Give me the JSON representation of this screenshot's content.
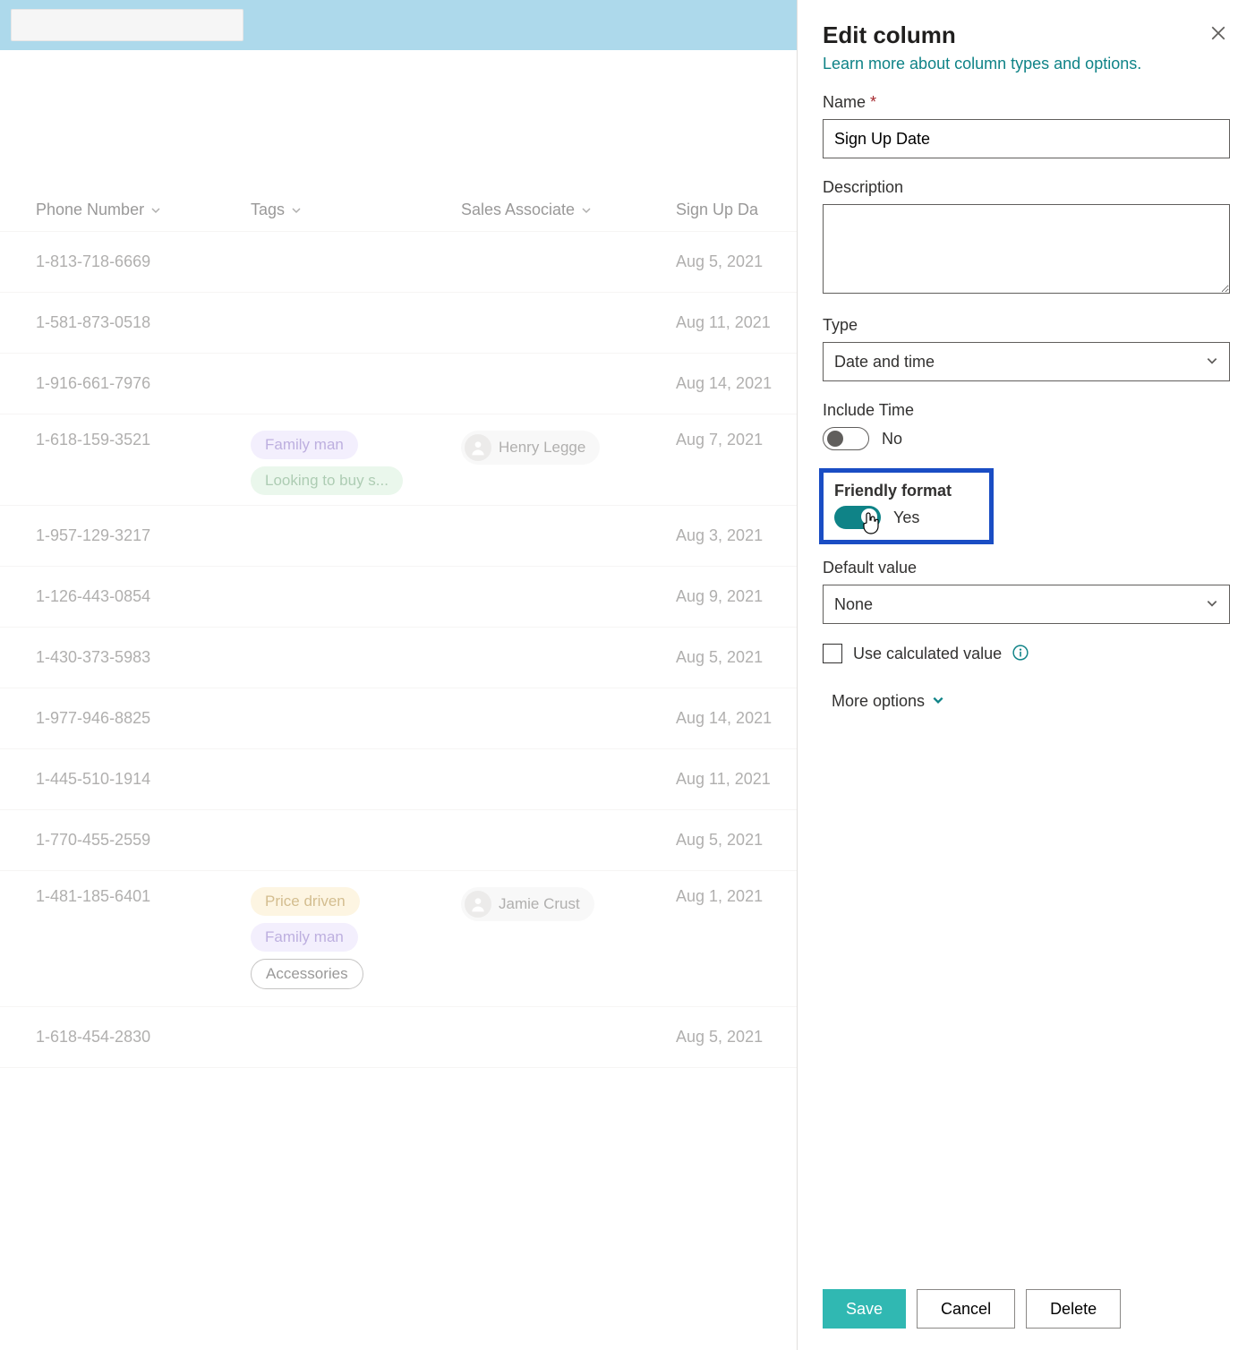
{
  "columns": {
    "phone": "Phone Number",
    "tags": "Tags",
    "assoc": "Sales Associate",
    "date": "Sign Up Da"
  },
  "rows": [
    {
      "phone": "1-813-718-6669",
      "tags": [],
      "assoc": "",
      "date": "Aug 5, 2021"
    },
    {
      "phone": "1-581-873-0518",
      "tags": [],
      "assoc": "",
      "date": "Aug 11, 2021"
    },
    {
      "phone": "1-916-661-7976",
      "tags": [],
      "assoc": "",
      "date": "Aug 14, 2021"
    },
    {
      "phone": "1-618-159-3521",
      "tags": [
        {
          "t": "Family man",
          "c": "purple"
        },
        {
          "t": "Looking to buy s...",
          "c": "green"
        }
      ],
      "assoc": "Henry Legge",
      "date": "Aug 7, 2021"
    },
    {
      "phone": "1-957-129-3217",
      "tags": [],
      "assoc": "",
      "date": "Aug 3, 2021"
    },
    {
      "phone": "1-126-443-0854",
      "tags": [],
      "assoc": "",
      "date": "Aug 9, 2021"
    },
    {
      "phone": "1-430-373-5983",
      "tags": [],
      "assoc": "",
      "date": "Aug 5, 2021"
    },
    {
      "phone": "1-977-946-8825",
      "tags": [],
      "assoc": "",
      "date": "Aug 14, 2021"
    },
    {
      "phone": "1-445-510-1914",
      "tags": [],
      "assoc": "",
      "date": "Aug 11, 2021"
    },
    {
      "phone": "1-770-455-2559",
      "tags": [],
      "assoc": "",
      "date": "Aug 5, 2021"
    },
    {
      "phone": "1-481-185-6401",
      "tags": [
        {
          "t": "Price driven",
          "c": "yellow"
        },
        {
          "t": "Family man",
          "c": "purple"
        },
        {
          "t": "Accessories",
          "c": "outline"
        }
      ],
      "assoc": "Jamie Crust",
      "date": "Aug 1, 2021"
    },
    {
      "phone": "1-618-454-2830",
      "tags": [],
      "assoc": "",
      "date": "Aug 5, 2021"
    }
  ],
  "panel": {
    "title": "Edit column",
    "learn_link": "Learn more about column types and options.",
    "name_label": "Name",
    "name_value": "Sign Up Date",
    "desc_label": "Description",
    "desc_value": "",
    "type_label": "Type",
    "type_value": "Date and time",
    "include_time_label": "Include Time",
    "include_time_value": "No",
    "friendly_label": "Friendly format",
    "friendly_value": "Yes",
    "default_label": "Default value",
    "default_value": "None",
    "calc_label": "Use calculated value",
    "more_label": "More options",
    "save": "Save",
    "cancel": "Cancel",
    "delete": "Delete"
  }
}
